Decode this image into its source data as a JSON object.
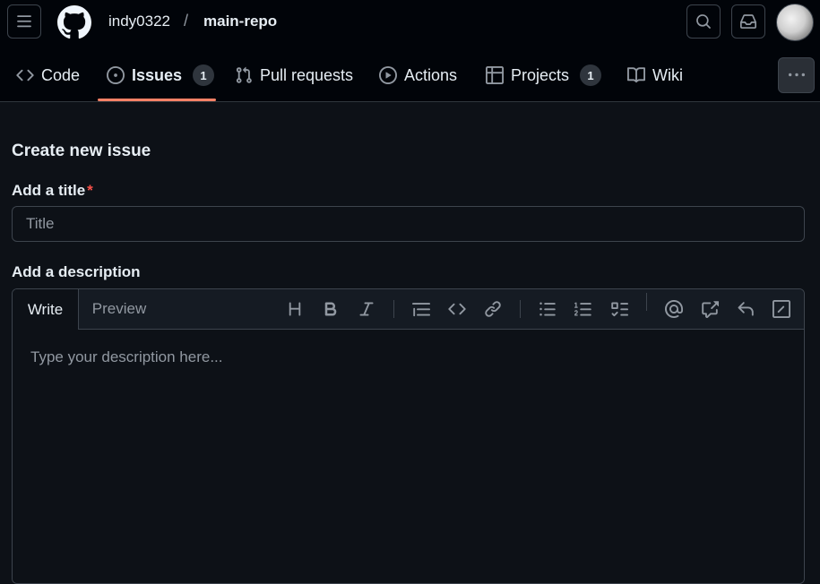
{
  "header": {
    "owner": "indy0322",
    "separator": "/",
    "repo": "main-repo",
    "icons": [
      "hamburger-icon",
      "github-logo",
      "search-icon",
      "inbox-icon",
      "avatar"
    ]
  },
  "tabs": [
    {
      "label": "Code",
      "icon": "code-icon"
    },
    {
      "label": "Issues",
      "icon": "issue-opened-icon",
      "count": "1",
      "active": true
    },
    {
      "label": "Pull requests",
      "icon": "git-pull-request-icon"
    },
    {
      "label": "Actions",
      "icon": "play-icon"
    },
    {
      "label": "Projects",
      "icon": "table-icon",
      "count": "1"
    },
    {
      "label": "Wiki",
      "icon": "book-icon"
    }
  ],
  "page": {
    "title": "Create new issue",
    "title_label": "Add a title",
    "required_mark": "*",
    "title_placeholder": "Title",
    "description_label": "Add a description",
    "description_placeholder": "Type your description here..."
  },
  "editor": {
    "write_tab": "Write",
    "preview_tab": "Preview",
    "toolbar_icons": [
      "heading-icon",
      "bold-icon",
      "italic-icon",
      "quote-icon",
      "code-icon",
      "link-icon",
      "unordered-list-icon",
      "ordered-list-icon",
      "task-list-icon",
      "mention-icon",
      "cross-reference-icon",
      "reply-icon",
      "slash-commands-icon"
    ]
  },
  "colors": {
    "background": "#0d1117",
    "header_background": "#010409",
    "active_tab_underline": "#f78166",
    "required": "#f85149"
  }
}
